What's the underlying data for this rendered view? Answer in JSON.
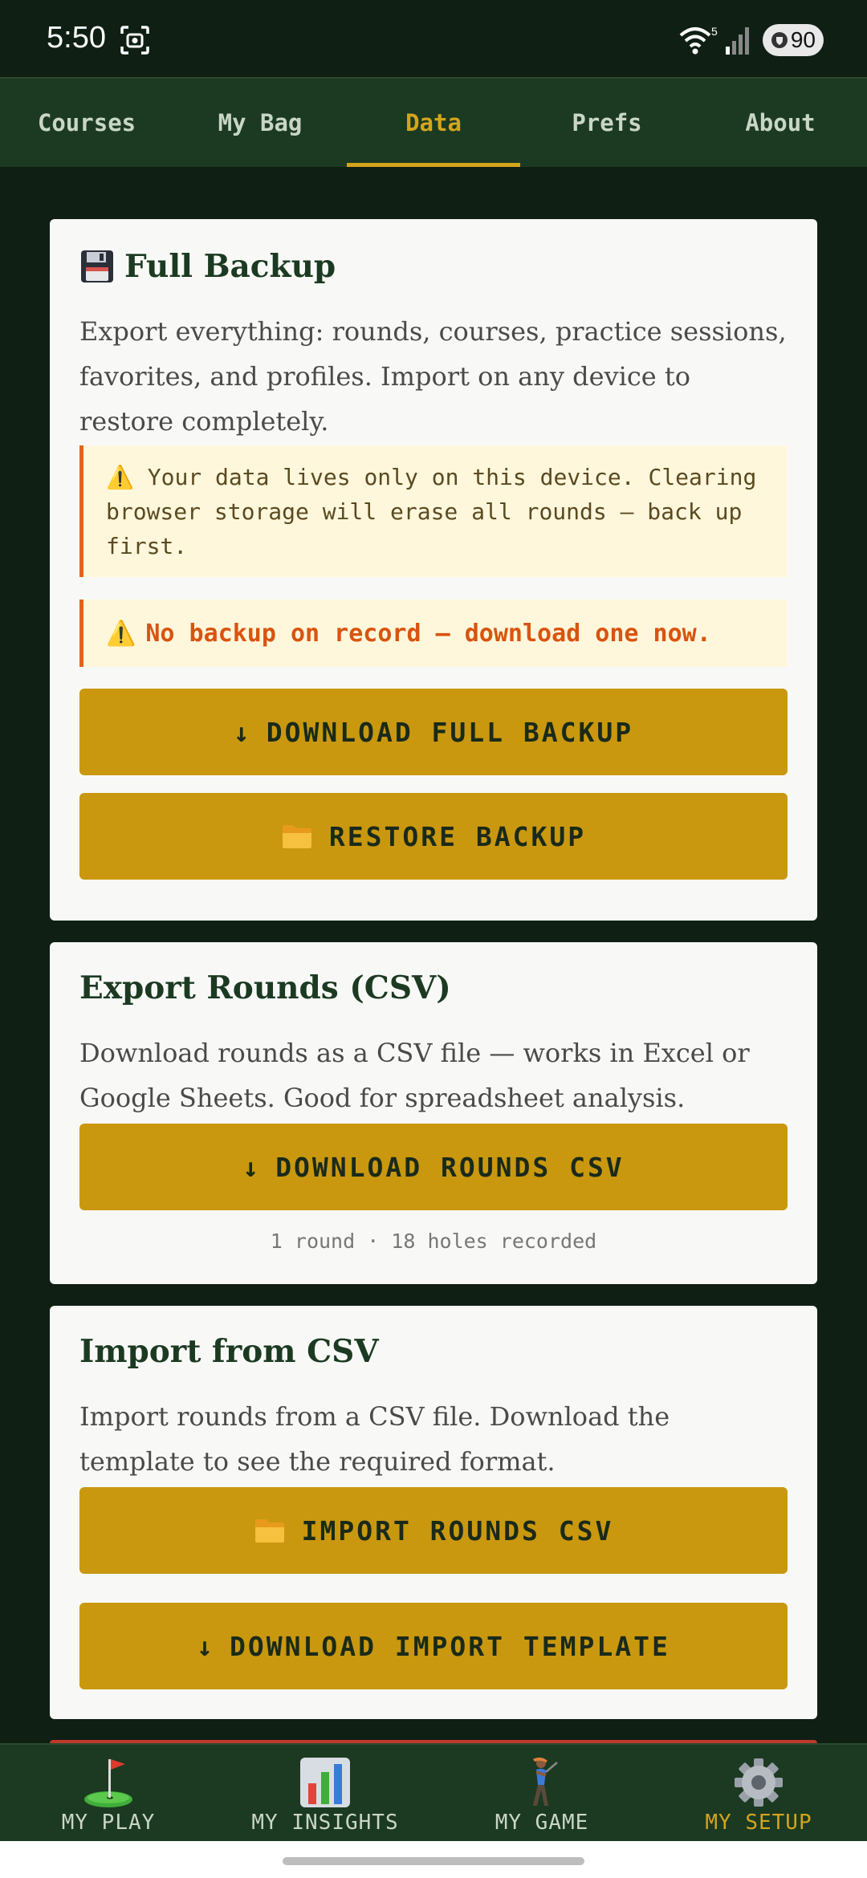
{
  "status_bar": {
    "time": "5:50",
    "wifi_badge": "5",
    "battery": "90"
  },
  "tabs": [
    {
      "label": "Courses",
      "active": false
    },
    {
      "label": "My Bag",
      "active": false
    },
    {
      "label": "Data",
      "active": true
    },
    {
      "label": "Prefs",
      "active": false
    },
    {
      "label": "About",
      "active": false
    }
  ],
  "full_backup": {
    "icon": "floppy-disk-icon",
    "title": "Full Backup",
    "description": "Export everything: rounds, courses, practice sessions, favorites, and profiles. Import on any device to restore completely.",
    "warning": "Your data lives only on this device. Clearing browser storage will erase all rounds — back up first.",
    "alert": "No backup on record — download one now.",
    "download_label": "DOWNLOAD FULL BACKUP",
    "restore_label": "RESTORE BACKUP"
  },
  "export_csv": {
    "title": "Export Rounds (CSV)",
    "description": "Download rounds as a CSV file — works in Excel or Google Sheets. Good for spreadsheet analysis.",
    "download_label": "DOWNLOAD ROUNDS CSV",
    "meta": "1 round · 18 holes recorded"
  },
  "import_csv": {
    "title": "Import from CSV",
    "description": "Import rounds from a CSV file. Download the template to see the required format.",
    "import_label": "IMPORT ROUNDS CSV",
    "template_label": "DOWNLOAD IMPORT TEMPLATE"
  },
  "bottom_nav": [
    {
      "label": "MY PLAY",
      "icon": "golf-flag-icon",
      "active": false
    },
    {
      "label": "MY INSIGHTS",
      "icon": "bar-chart-icon",
      "active": false
    },
    {
      "label": "MY GAME",
      "icon": "golfer-icon",
      "active": false
    },
    {
      "label": "MY SETUP",
      "icon": "gear-icon",
      "active": true
    }
  ],
  "colors": {
    "background": "#0f1f14",
    "nav": "#1c3a22",
    "accent": "#d4a51c",
    "button": "#c9980f",
    "warning_border": "#e0661a",
    "warning_bg": "#fff7dc"
  }
}
